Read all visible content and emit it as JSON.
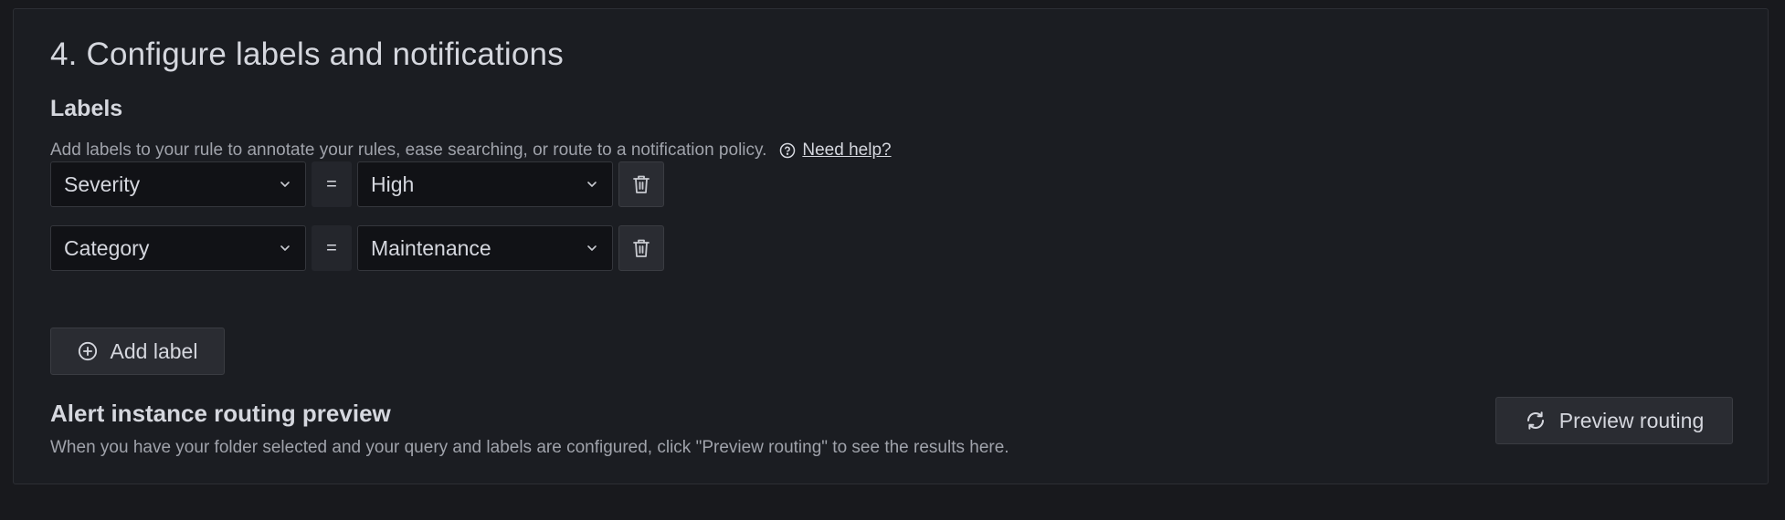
{
  "section": {
    "title": "4. Configure labels and notifications"
  },
  "labels": {
    "heading": "Labels",
    "description": "Add labels to your rule to annotate your rules, ease searching, or route to a notification policy.",
    "help_link": "Need help?",
    "rows": [
      {
        "key": "Severity",
        "operator": "=",
        "value": "High"
      },
      {
        "key": "Category",
        "operator": "=",
        "value": "Maintenance"
      }
    ],
    "add_label": "Add label"
  },
  "routing": {
    "heading": "Alert instance routing preview",
    "description": "When you have your folder selected and your query and labels are configured, click \"Preview routing\" to see the results here.",
    "preview_button": "Preview routing"
  },
  "icons": {
    "help": "help-circle-icon",
    "chevron": "chevron-down-icon",
    "trash": "trash-icon",
    "add": "plus-circle-icon",
    "refresh": "refresh-icon"
  },
  "colors": {
    "background": "#18191d",
    "panel": "#1b1d22",
    "input": "#111216",
    "button": "#2a2c32",
    "text_primary": "#d5d7de",
    "text_secondary": "#a0a3ab"
  }
}
